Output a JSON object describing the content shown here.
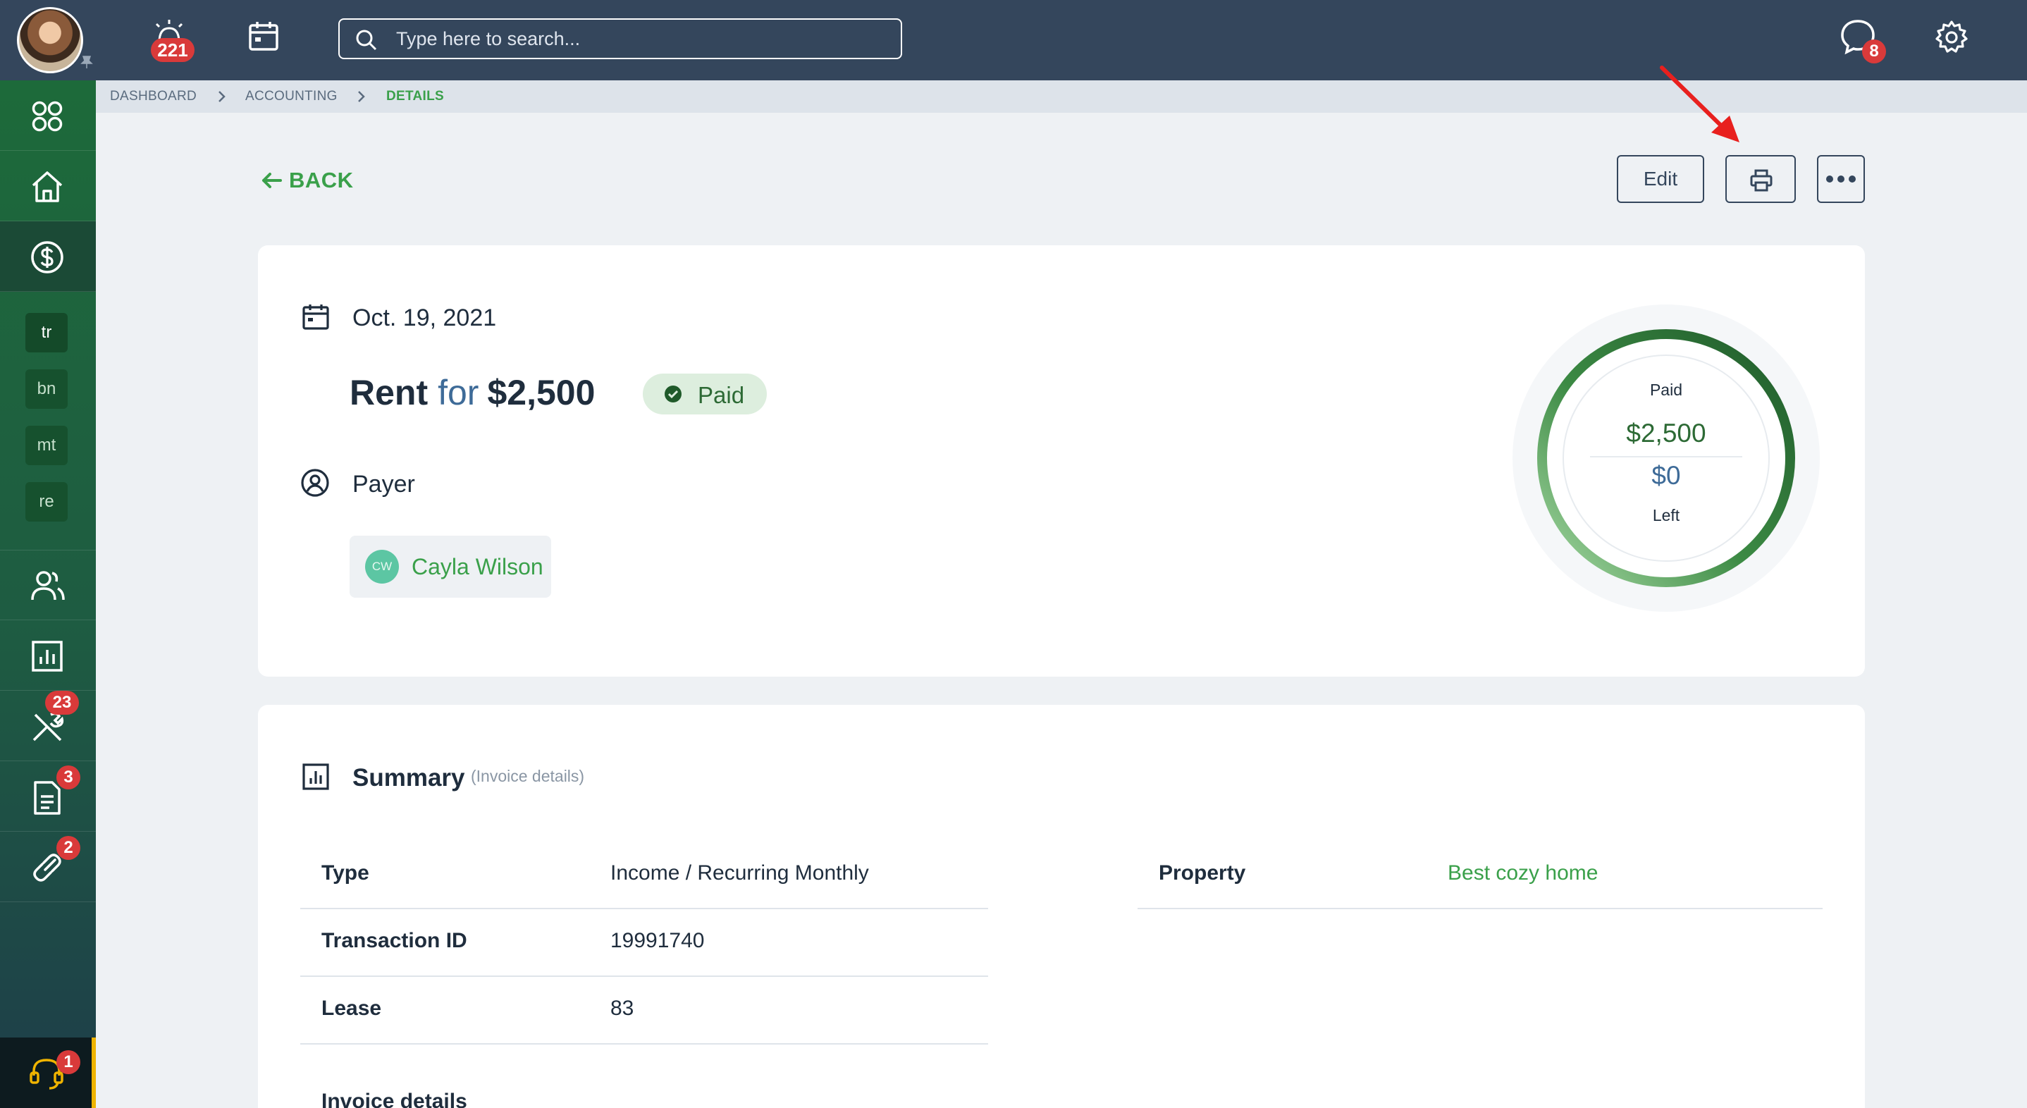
{
  "topbar": {
    "notifications_count": "221",
    "messages_count": "8",
    "search_placeholder": "Type here to search..."
  },
  "breadcrumb": {
    "items": [
      "DASHBOARD",
      "ACCOUNTING",
      "DETAILS"
    ]
  },
  "sidebar": {
    "sub_items": [
      "tr",
      "bn",
      "mt",
      "re"
    ],
    "maintenance_count": "23",
    "documents_count": "3",
    "links_count": "2",
    "support_count": "1"
  },
  "actions": {
    "back_label": "BACK",
    "edit_label": "Edit"
  },
  "transaction": {
    "date": "Oct. 19, 2021",
    "category": "Rent",
    "for_word": "for",
    "amount": "$2,500",
    "status": "Paid",
    "payer_heading": "Payer",
    "payer_initials": "CW",
    "payer_name": "Cayla Wilson"
  },
  "progress": {
    "paid_label": "Paid",
    "paid_amount": "$2,500",
    "left_amount": "$0",
    "left_label": "Left",
    "paid_fraction": 1.0
  },
  "summary": {
    "title": "Summary",
    "subtitle": "(Invoice details)",
    "rows_left": [
      {
        "label": "Type",
        "value": "Income / Recurring Monthly"
      },
      {
        "label": "Transaction ID",
        "value": "19991740"
      },
      {
        "label": "Lease",
        "value": "83"
      }
    ],
    "rows_right": [
      {
        "label": "Property",
        "value": "Best cozy home"
      }
    ],
    "invoice_details_heading": "Invoice details"
  },
  "colors": {
    "accent_green": "#3aa04a",
    "topbar": "#34465c",
    "badge_red": "#d93a3a"
  }
}
